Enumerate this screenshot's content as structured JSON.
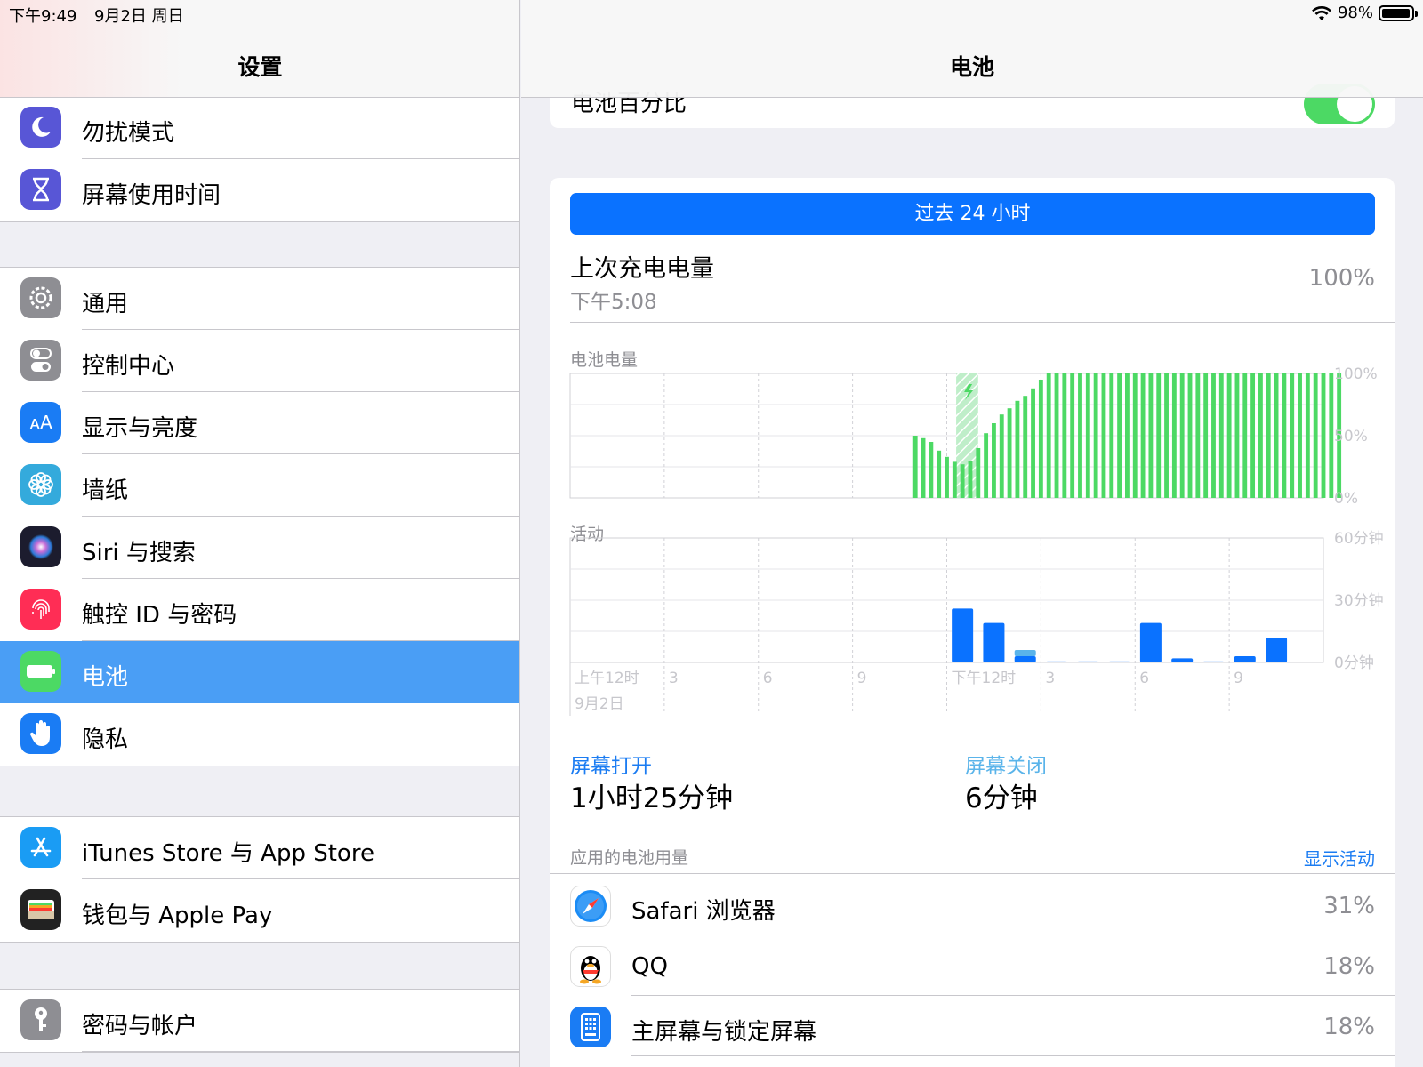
{
  "status_bar": {
    "time": "下午9:49",
    "date": "9月2日 周日",
    "battery_text": "98%"
  },
  "left": {
    "title": "设置",
    "groups": [
      {
        "items": [
          {
            "label": "勿扰模式",
            "icon": "moon-icon",
            "color": "#5856d6"
          },
          {
            "label": "屏幕使用时间",
            "icon": "hourglass-icon",
            "color": "#5856d6"
          }
        ]
      },
      {
        "items": [
          {
            "label": "通用",
            "icon": "gear-icon",
            "color": "#8e8e93"
          },
          {
            "label": "控制中心",
            "icon": "toggles-icon",
            "color": "#8e8e93"
          },
          {
            "label": "显示与亮度",
            "icon": "text-size-icon",
            "color": "#1a7cf4"
          },
          {
            "label": "墙纸",
            "icon": "flower-icon",
            "color": "#34aadc"
          },
          {
            "label": "Siri 与搜索",
            "icon": "siri-icon",
            "color": "#222"
          },
          {
            "label": "触控 ID 与密码",
            "icon": "fingerprint-icon",
            "color": "#ff2d55"
          },
          {
            "label": "电池",
            "icon": "battery-icon",
            "color": "#4cd964"
          },
          {
            "label": "隐私",
            "icon": "hand-icon",
            "color": "#1a7cf4"
          }
        ]
      },
      {
        "items": [
          {
            "label": "iTunes Store 与 App Store",
            "icon": "app-store-icon",
            "color": "#1a9cf4"
          },
          {
            "label": "钱包与 Apple Pay",
            "icon": "wallet-icon",
            "color": "#222"
          }
        ]
      },
      {
        "items": [
          {
            "label": "密码与帐户",
            "icon": "key-icon",
            "color": "#8e8e93"
          }
        ]
      }
    ]
  },
  "right": {
    "title": "电池",
    "battery_percentage_label": "电池百分比",
    "segment_label": "过去 24 小时",
    "last_charge": {
      "label": "上次充电电量",
      "time": "下午5:08",
      "value": "100%"
    },
    "battery_level_title": "电池电量",
    "activity_title": "活动",
    "screen_on": {
      "label": "屏幕打开",
      "value": "1小时25分钟"
    },
    "screen_off": {
      "label": "屏幕关闭",
      "value": "6分钟"
    },
    "app_usage_title": "应用的电池用量",
    "show_activity": "显示活动",
    "apps": [
      {
        "name": "Safari 浏览器",
        "pct": "31%",
        "icon": "safari-icon"
      },
      {
        "name": "QQ",
        "pct": "18%",
        "icon": "qq-icon"
      },
      {
        "name": "主屏幕与锁定屏幕",
        "pct": "18%",
        "icon": "home-screen-icon"
      }
    ]
  },
  "chart_data": [
    {
      "type": "bar",
      "title": "电池电量",
      "y_ticks": [
        "100%",
        "50%",
        "0%"
      ],
      "ylim": [
        0,
        100
      ],
      "x_ticks": [
        "上午12时",
        "3",
        "6",
        "9",
        "下午12时",
        "3",
        "6",
        "9"
      ],
      "x_date": "9月2日",
      "charging_start_hour": 12.3,
      "charging_end_hour": 13.0,
      "bar_start_hour": 11.0,
      "bar_step_hours": 0.25,
      "values": [
        50,
        48,
        45,
        38,
        33,
        29,
        27,
        30,
        40,
        52,
        60,
        67,
        72,
        78,
        82,
        88,
        95,
        100,
        100,
        100,
        100,
        100,
        100,
        100,
        100,
        100,
        100,
        100,
        100,
        100,
        100,
        100,
        100,
        100,
        100,
        100,
        100,
        100,
        100,
        100,
        100,
        100,
        100,
        100,
        100,
        100,
        100,
        100,
        100,
        100,
        100,
        100,
        100,
        100,
        100
      ],
      "colors": {
        "bar": "#4cd964",
        "charging": "#bfeec9"
      }
    },
    {
      "type": "bar",
      "title": "活动",
      "y_ticks": [
        "60分钟",
        "30分钟",
        "0分钟"
      ],
      "ylim": [
        0,
        60
      ],
      "bar_hours": [
        12,
        13,
        14,
        15,
        16,
        17,
        18,
        19,
        20,
        21,
        22
      ],
      "screen_on": [
        26,
        19,
        3,
        0.5,
        0.5,
        0.5,
        19,
        2,
        0.5,
        3,
        12
      ],
      "screen_off": [
        0,
        0,
        3,
        0,
        0,
        0,
        0,
        0,
        0,
        0,
        0
      ],
      "colors": {
        "screen_on": "#0a72ff",
        "screen_off": "#5ab4ea"
      }
    }
  ]
}
